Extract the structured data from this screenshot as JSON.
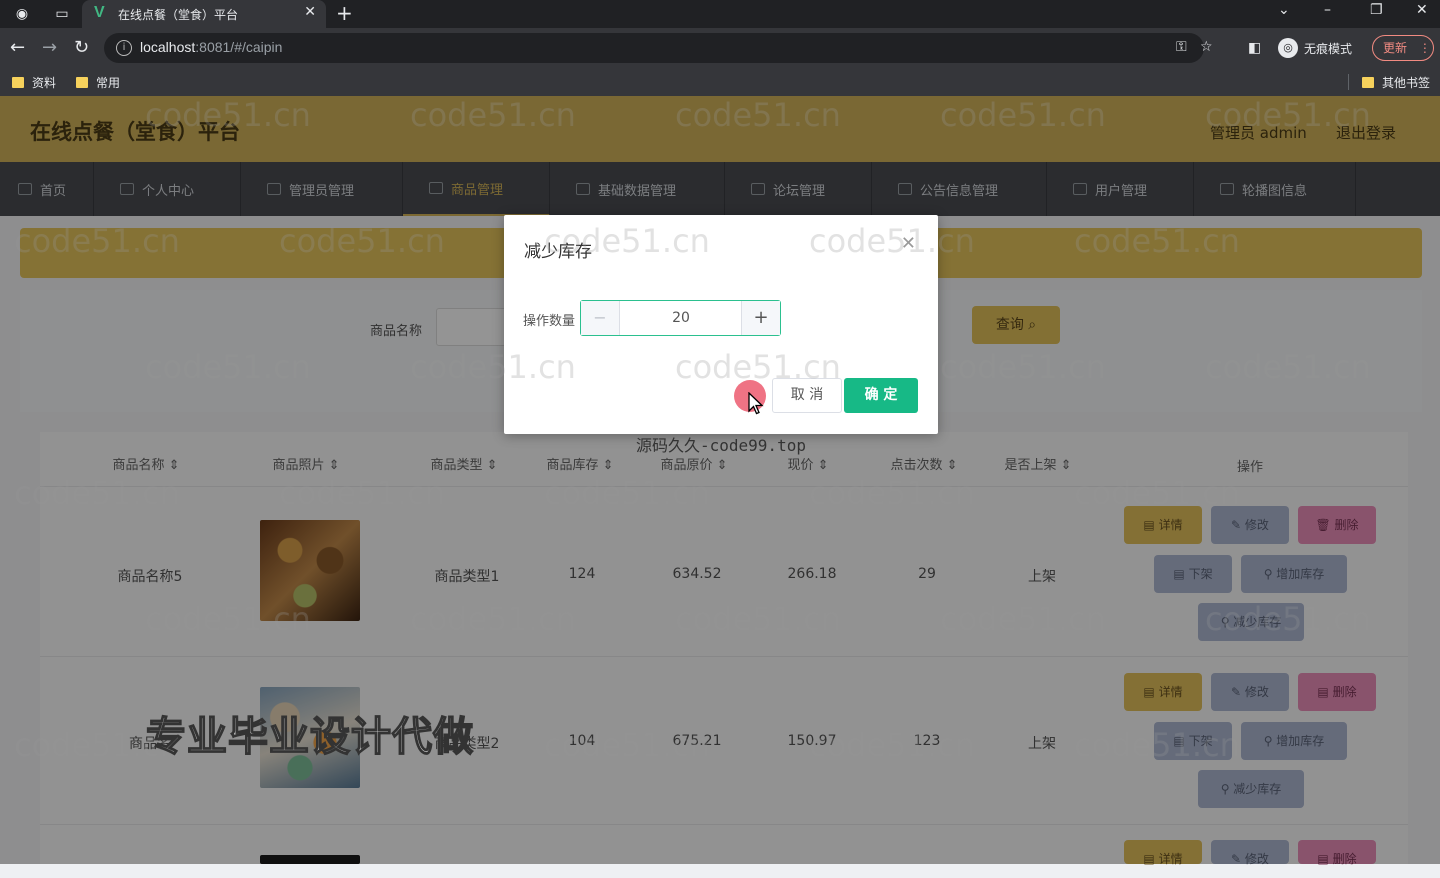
{
  "browser": {
    "tab_title": "在线点餐（堂食）平台",
    "url_host": "localhost",
    "url_rest": ":8081/#/caipin",
    "incognito_label": "无痕模式",
    "update_label": "更新",
    "bookmarks": [
      "资料",
      "常用"
    ],
    "other_bookmarks": "其他书签"
  },
  "header": {
    "title": "在线点餐（堂食）平台",
    "user": "管理员 admin",
    "logout": "退出登录"
  },
  "menu": [
    "首页",
    "个人中心",
    "管理员管理",
    "商品管理",
    "基础数据管理",
    "论坛管理",
    "公告信息管理",
    "用户管理",
    "轮播图信息"
  ],
  "active_menu": "商品管理",
  "search": {
    "label": "商品名称",
    "button": "查询"
  },
  "table": {
    "headers": [
      "商品名称",
      "商品照片",
      "商品类型",
      "商品库存",
      "商品原价",
      "现价",
      "点击次数",
      "是否上架",
      "操作"
    ],
    "rows": [
      {
        "name": "商品名称5",
        "type": "商品类型1",
        "stock": "124",
        "orig": "634.52",
        "price": "266.18",
        "clicks": "29",
        "status": "上架"
      },
      {
        "name": "商品名",
        "type": "商品类型2",
        "stock": "104",
        "orig": "675.21",
        "price": "150.97",
        "clicks": "123",
        "status": "上架"
      }
    ],
    "actions": {
      "detail": "详情",
      "edit": "修改",
      "delete": "删除",
      "down": "下架",
      "add_stock": "增加库存",
      "reduce_stock": "减少库存"
    }
  },
  "dialog": {
    "title": "减少库存",
    "field_label": "操作数量",
    "value": "20",
    "cancel": "取 消",
    "confirm": "确 定"
  },
  "watermarks": {
    "site": "code51.cn",
    "source": "源码久久-code99.top",
    "promo": "专业毕业设计代做"
  },
  "colors": {
    "header": "#d2b45b",
    "menu": "#4a4d52",
    "confirm": "#17b986",
    "stepper_border": "#2bc08f"
  }
}
